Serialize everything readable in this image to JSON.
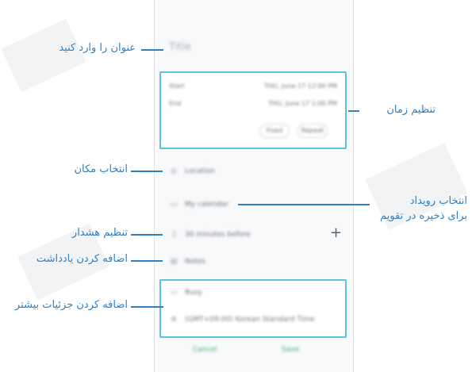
{
  "callouts": {
    "title": "عنوان را وارد کنید",
    "time": "تنظیم زمان",
    "location": "انتخاب مکان",
    "calendar_line1": "انتخاب رویداد",
    "calendar_line2": "برای ذخیره در تقویم",
    "reminder": "تنظیم هشدار",
    "note": "اضافه کردن یادداشت",
    "details": "اضافه کردن جزئیات بیشتر"
  },
  "form": {
    "title_placeholder": "Title",
    "start_label": "Start",
    "start_value": "THU, June 17   12:00 PM",
    "end_label": "End",
    "end_value": "THU, June 17   1:00 PM",
    "all_day": "Fixed",
    "repeat": "Repeat",
    "location": "Location",
    "calendar": "My calendar",
    "reminder": "30 minutes before",
    "note": "Notes",
    "more_1": "Busy",
    "more_2": "(GMT+09:00) Korean Standard Time",
    "cancel": "Cancel",
    "save": "Save"
  },
  "icons": {
    "location": "location-pin-icon",
    "calendar": "calendar-icon",
    "reminder": "bell-icon",
    "note": "note-icon",
    "status": "status-icon",
    "timezone": "globe-icon",
    "add": "plus-icon"
  },
  "colors": {
    "highlight": "#5cc2dd",
    "callout_text": "#2f7fc1",
    "action_text": "#3fae6a"
  }
}
